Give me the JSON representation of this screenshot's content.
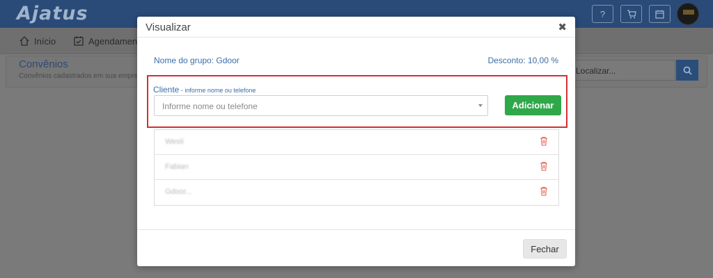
{
  "app": {
    "logo": "Ajatus",
    "topbar_buttons": [
      {
        "icon": "question-icon",
        "symbol": "?"
      },
      {
        "icon": "cart-icon",
        "symbol": ""
      },
      {
        "icon": "calendar-icon",
        "symbol": ""
      }
    ]
  },
  "nav": {
    "items": [
      {
        "label": "Início",
        "icon": "home-icon"
      },
      {
        "label": "Agendamen",
        "icon": "calendar-check-icon"
      }
    ]
  },
  "page": {
    "title": "Convênios",
    "subtitle": "Convênios cadastrados em sua empre",
    "search_text": "Localizar..."
  },
  "modal": {
    "title": "Visualizar",
    "close_symbol": "✖",
    "group_name": "Nome do grupo: Gdoor",
    "discount": "Desconto: 10,00 %",
    "client_label": "Cliente",
    "client_hint": " - informe nome ou telefone",
    "client_placeholder": "Informe nome ou telefone",
    "add_button": "Adicionar",
    "clients": [
      {
        "name": "Wesli"
      },
      {
        "name": "Fabian"
      },
      {
        "name": "Gdoor..."
      }
    ],
    "close_button": "Fechar"
  },
  "colors": {
    "highlight": "#d32f2f",
    "add_button": "#2fa84a",
    "link_blue": "#3a6ea5",
    "trash": "#e05a4a"
  }
}
